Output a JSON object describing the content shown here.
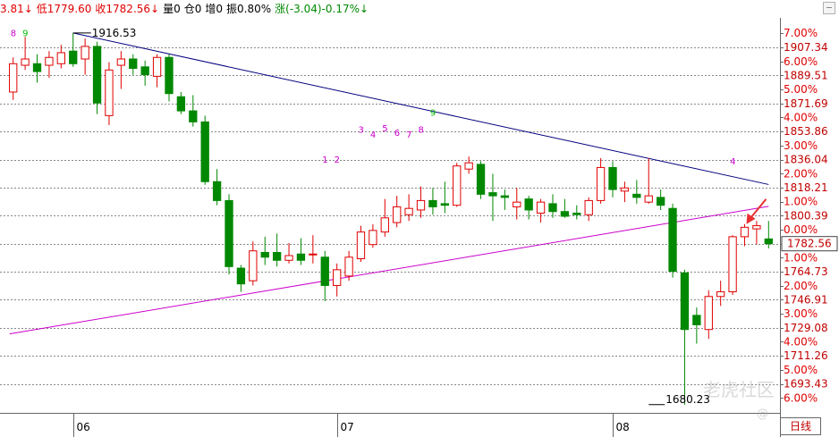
{
  "header": {
    "items": [
      {
        "text": "3.81↓",
        "color": "#e00000"
      },
      {
        "text": "低1779.60",
        "color": "#e00000"
      },
      {
        "text": "收1782.56↓",
        "color": "#e00000"
      },
      {
        "text": "量0",
        "color": "#000000"
      },
      {
        "text": "仓0",
        "color": "#000000"
      },
      {
        "text": "增0",
        "color": "#000000"
      },
      {
        "text": "振0.80%",
        "color": "#000000"
      },
      {
        "text": "涨(-3.04)-0.17%↓",
        "color": "#008800"
      }
    ]
  },
  "period_label": "日线",
  "watermark": "老虎社区",
  "watermark_sub": "@",
  "colors": {
    "up": "#e00000",
    "down": "#008800",
    "trend_blue": "#00007f",
    "trend_magenta": "#cc00cc",
    "grid": "#888888",
    "arrow": "#e83030",
    "seq_green": "#00bb00",
    "seq_magenta": "#cc00cc"
  },
  "chart_data": {
    "type": "candlestick",
    "y_range": [
      1675,
      1925
    ],
    "price_labels": [
      {
        "label": "7.00%",
        "value": 1916.53
      },
      {
        "label": "1907.34",
        "value": 1907.34
      },
      {
        "label": "6.00%",
        "value": 1898.4
      },
      {
        "label": "1889.51",
        "value": 1889.51
      },
      {
        "label": "5.00%",
        "value": 1880.6
      },
      {
        "label": "1871.69",
        "value": 1871.69
      },
      {
        "label": "4.00%",
        "value": 1862.8
      },
      {
        "label": "1853.86",
        "value": 1853.86
      },
      {
        "label": "3.00%",
        "value": 1844.9
      },
      {
        "label": "1836.04",
        "value": 1836.04
      },
      {
        "label": "2.00%",
        "value": 1827.1
      },
      {
        "label": "1818.21",
        "value": 1818.21
      },
      {
        "label": "1.00%",
        "value": 1809.3
      },
      {
        "label": "1800.39",
        "value": 1800.39
      },
      {
        "label": "0.00%",
        "value": 1791.5
      },
      {
        "label": "1782.56",
        "value": 1782.56
      },
      {
        "label": "1.00%",
        "value": 1773.6
      },
      {
        "label": "1764.73",
        "value": 1764.73
      },
      {
        "label": "2.00%",
        "value": 1755.8
      },
      {
        "label": "1746.91",
        "value": 1746.91
      },
      {
        "label": "3.00%",
        "value": 1738.0
      },
      {
        "label": "1729.08",
        "value": 1729.08
      },
      {
        "label": "4.00%",
        "value": 1720.2
      },
      {
        "label": "1711.26",
        "value": 1711.26
      },
      {
        "label": "5.00%",
        "value": 1702.3
      },
      {
        "label": "1693.43",
        "value": 1693.43
      },
      {
        "label": "6.00%",
        "value": 1684.5
      }
    ],
    "grid_values": [
      1907.34,
      1889.51,
      1871.69,
      1853.86,
      1836.04,
      1818.21,
      1800.39,
      1782.56,
      1764.73,
      1746.91,
      1729.08,
      1711.26,
      1693.43
    ],
    "month_labels": [
      {
        "label": "06",
        "index": 5
      },
      {
        "label": "07",
        "index": 27
      },
      {
        "label": "08",
        "index": 50
      }
    ],
    "high_annotation": {
      "label": "1916.53",
      "index": 5,
      "value": 1916.53
    },
    "low_annotation": {
      "label": "1680.23",
      "index": 53,
      "value": 1680.23
    },
    "current_price": {
      "label": "1782.56",
      "value": 1782.56
    },
    "candles": [
      {
        "o": 1879,
        "h": 1901,
        "l": 1874,
        "c": 1897
      },
      {
        "o": 1896,
        "h": 1914,
        "l": 1893,
        "c": 1900
      },
      {
        "o": 1897,
        "h": 1903,
        "l": 1885,
        "c": 1892
      },
      {
        "o": 1896,
        "h": 1905,
        "l": 1888,
        "c": 1901
      },
      {
        "o": 1897,
        "h": 1909,
        "l": 1894,
        "c": 1904
      },
      {
        "o": 1905,
        "h": 1916.53,
        "l": 1895,
        "c": 1897
      },
      {
        "o": 1900,
        "h": 1913,
        "l": 1890,
        "c": 1908
      },
      {
        "o": 1908,
        "h": 1911,
        "l": 1865,
        "c": 1872
      },
      {
        "o": 1864,
        "h": 1898,
        "l": 1858,
        "c": 1893
      },
      {
        "o": 1896,
        "h": 1905,
        "l": 1881,
        "c": 1900
      },
      {
        "o": 1900,
        "h": 1903,
        "l": 1890,
        "c": 1894
      },
      {
        "o": 1895,
        "h": 1899,
        "l": 1883,
        "c": 1890
      },
      {
        "o": 1889,
        "h": 1903,
        "l": 1882,
        "c": 1901
      },
      {
        "o": 1901,
        "h": 1903,
        "l": 1873,
        "c": 1878
      },
      {
        "o": 1876,
        "h": 1879,
        "l": 1865,
        "c": 1867
      },
      {
        "o": 1867,
        "h": 1877,
        "l": 1857,
        "c": 1860
      },
      {
        "o": 1860,
        "h": 1864,
        "l": 1820,
        "c": 1822
      },
      {
        "o": 1822,
        "h": 1830,
        "l": 1807,
        "c": 1810
      },
      {
        "o": 1810,
        "h": 1814,
        "l": 1763,
        "c": 1768
      },
      {
        "o": 1767,
        "h": 1769,
        "l": 1752,
        "c": 1757
      },
      {
        "o": 1759,
        "h": 1784,
        "l": 1756,
        "c": 1778
      },
      {
        "o": 1777,
        "h": 1787,
        "l": 1769,
        "c": 1774
      },
      {
        "o": 1777,
        "h": 1789,
        "l": 1768,
        "c": 1772
      },
      {
        "o": 1772,
        "h": 1783,
        "l": 1770,
        "c": 1775
      },
      {
        "o": 1776,
        "h": 1786,
        "l": 1769,
        "c": 1772
      },
      {
        "o": 1776,
        "h": 1788,
        "l": 1770,
        "c": 1776
      },
      {
        "o": 1774,
        "h": 1778,
        "l": 1746,
        "c": 1756
      },
      {
        "o": 1756,
        "h": 1770,
        "l": 1749,
        "c": 1766
      },
      {
        "o": 1762,
        "h": 1778,
        "l": 1759,
        "c": 1774
      },
      {
        "o": 1773,
        "h": 1794,
        "l": 1771,
        "c": 1790
      },
      {
        "o": 1782,
        "h": 1795,
        "l": 1780,
        "c": 1791
      },
      {
        "o": 1790,
        "h": 1811,
        "l": 1787,
        "c": 1799
      },
      {
        "o": 1796,
        "h": 1813,
        "l": 1793,
        "c": 1806
      },
      {
        "o": 1801,
        "h": 1814,
        "l": 1797,
        "c": 1805
      },
      {
        "o": 1804,
        "h": 1819,
        "l": 1799,
        "c": 1810
      },
      {
        "o": 1810,
        "h": 1818,
        "l": 1801,
        "c": 1806
      },
      {
        "o": 1808,
        "h": 1822,
        "l": 1802,
        "c": 1807
      },
      {
        "o": 1807,
        "h": 1834,
        "l": 1806,
        "c": 1832
      },
      {
        "o": 1830,
        "h": 1838,
        "l": 1827,
        "c": 1834
      },
      {
        "o": 1833,
        "h": 1835,
        "l": 1811,
        "c": 1814
      },
      {
        "o": 1815,
        "h": 1827,
        "l": 1797,
        "c": 1813
      },
      {
        "o": 1813,
        "h": 1817,
        "l": 1804,
        "c": 1812
      },
      {
        "o": 1806,
        "h": 1818,
        "l": 1798,
        "c": 1809
      },
      {
        "o": 1811,
        "h": 1813,
        "l": 1798,
        "c": 1804
      },
      {
        "o": 1802,
        "h": 1811,
        "l": 1796,
        "c": 1809
      },
      {
        "o": 1808,
        "h": 1814,
        "l": 1799,
        "c": 1803
      },
      {
        "o": 1803,
        "h": 1811,
        "l": 1799,
        "c": 1800
      },
      {
        "o": 1802,
        "h": 1807,
        "l": 1798,
        "c": 1801
      },
      {
        "o": 1801,
        "h": 1812,
        "l": 1797,
        "c": 1810
      },
      {
        "o": 1810,
        "h": 1837,
        "l": 1808,
        "c": 1831
      },
      {
        "o": 1831,
        "h": 1835,
        "l": 1812,
        "c": 1817
      },
      {
        "o": 1816,
        "h": 1822,
        "l": 1809,
        "c": 1818
      },
      {
        "o": 1814,
        "h": 1823,
        "l": 1808,
        "c": 1812
      },
      {
        "o": 1809,
        "h": 1837,
        "l": 1808,
        "c": 1813
      },
      {
        "o": 1812,
        "h": 1817,
        "l": 1804,
        "c": 1807
      },
      {
        "o": 1805,
        "h": 1808,
        "l": 1761,
        "c": 1765
      },
      {
        "o": 1764,
        "h": 1766,
        "l": 1680.23,
        "c": 1728
      },
      {
        "o": 1737,
        "h": 1742,
        "l": 1719,
        "c": 1731
      },
      {
        "o": 1728,
        "h": 1753,
        "l": 1722,
        "c": 1749
      },
      {
        "o": 1749,
        "h": 1759,
        "l": 1743,
        "c": 1752
      },
      {
        "o": 1752,
        "h": 1788,
        "l": 1750,
        "c": 1787
      },
      {
        "o": 1787,
        "h": 1795,
        "l": 1781,
        "c": 1793
      },
      {
        "o": 1792,
        "h": 1797,
        "l": 1782,
        "c": 1794
      },
      {
        "o": 1785.6,
        "h": 1797,
        "l": 1779.6,
        "c": 1782.56
      }
    ],
    "trend_lines": [
      {
        "name": "",
        "color": "trend_blue",
        "from": {
          "index": 5,
          "value": 1916.53
        },
        "to": {
          "index": 63,
          "value": 1820.2
        }
      },
      {
        "name": "",
        "color": "trend_magenta",
        "from": {
          "index": -0.3,
          "value": 1725.2
        },
        "to": {
          "index": 63,
          "value": 1806.3
        }
      }
    ],
    "sequence_marks": [
      {
        "text": "8",
        "index": 0,
        "value": 1914.5,
        "color": "seq_magenta"
      },
      {
        "text": "9",
        "index": 1,
        "value": 1914.5,
        "color": "seq_green"
      },
      {
        "text": "1",
        "index": 26,
        "value": 1834,
        "color": "seq_magenta"
      },
      {
        "text": "2",
        "index": 27,
        "value": 1834,
        "color": "seq_magenta"
      },
      {
        "text": "3",
        "index": 29,
        "value": 1853,
        "color": "seq_magenta"
      },
      {
        "text": "4",
        "index": 30,
        "value": 1850,
        "color": "seq_magenta"
      },
      {
        "text": "5",
        "index": 31,
        "value": 1854,
        "color": "seq_magenta"
      },
      {
        "text": "6",
        "index": 32,
        "value": 1851,
        "color": "seq_magenta"
      },
      {
        "text": "7",
        "index": 33,
        "value": 1850,
        "color": "seq_magenta"
      },
      {
        "text": "8",
        "index": 34,
        "value": 1853,
        "color": "seq_magenta"
      },
      {
        "text": "9",
        "index": 35,
        "value": 1864,
        "color": "seq_green"
      },
      {
        "text": "4",
        "index": 60,
        "value": 1833,
        "color": "seq_magenta"
      }
    ],
    "arrow_target": {
      "index": 61,
      "value": 1795
    }
  }
}
